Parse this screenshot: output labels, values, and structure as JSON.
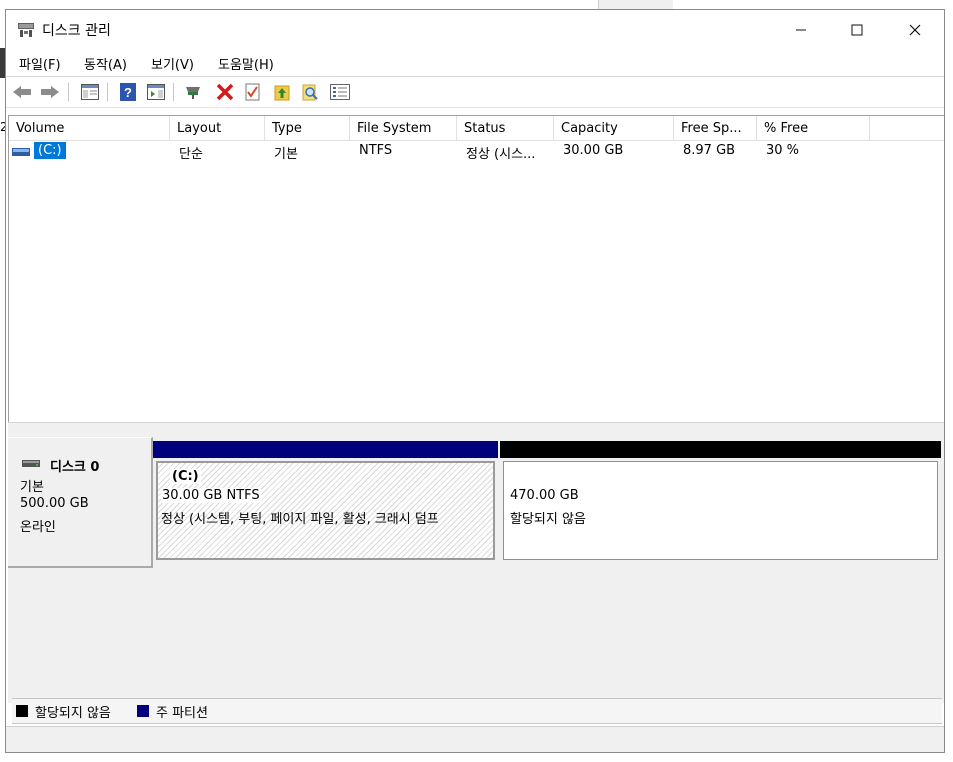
{
  "window": {
    "title": "디스크 관리"
  },
  "menu": [
    "파일(F)",
    "동작(A)",
    "보기(V)",
    "도움말(H)"
  ],
  "toolbar_icons": [
    "back-arrow-icon",
    "forward-arrow-icon",
    "console-tree-icon",
    "help-icon",
    "action-pane-icon",
    "connect-icon",
    "delete-icon",
    "properties-icon",
    "up-icon",
    "search-icon",
    "list-icon"
  ],
  "columns": [
    "Volume",
    "Layout",
    "Type",
    "File System",
    "Status",
    "Capacity",
    "Free Sp...",
    "% Free"
  ],
  "volumes": [
    {
      "volume": "(C:)",
      "layout": "단순",
      "type": "기본",
      "fs": "NTFS",
      "status": "정상 (시스...",
      "capacity": "30.00 GB",
      "free": "8.97 GB",
      "pct_free": "30 %"
    }
  ],
  "disk": {
    "name": "디스크 0",
    "kind": "기본",
    "size": "500.00 GB",
    "state": "온라인",
    "partitions": [
      {
        "label": "(C:)",
        "size_fs": "30.00 GB NTFS",
        "status": "정상 (시스템, 부팅, 페이지 파일, 활성, 크래시 덤프"
      },
      {
        "label": "",
        "size_fs": "470.00 GB",
        "status": "할당되지 않음"
      }
    ]
  },
  "legend": [
    {
      "label": "할당되지 않음",
      "color": "#000000"
    },
    {
      "label": "주 파티션",
      "color": "#00007f"
    }
  ],
  "background_fragment": "2"
}
